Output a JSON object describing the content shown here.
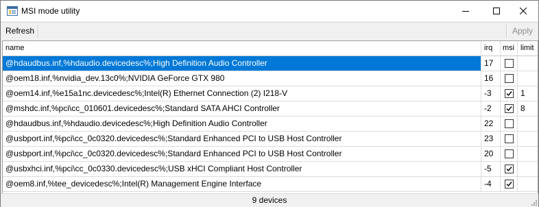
{
  "window": {
    "title": "MSI mode utility",
    "icon": "app-window-icon"
  },
  "toolbar": {
    "refresh_label": "Refresh",
    "apply_label": "Apply"
  },
  "columns": {
    "name": "name",
    "irq": "irq",
    "msi": "msi",
    "limit": "limit"
  },
  "rows": [
    {
      "name": "@hdaudbus.inf,%hdaudio.devicedesc%;High Definition Audio Controller",
      "irq": "17",
      "msi": false,
      "limit": ""
    },
    {
      "name": "@oem18.inf,%nvidia_dev.13c0%;NVIDIA GeForce GTX 980",
      "irq": "16",
      "msi": false,
      "limit": ""
    },
    {
      "name": "@oem14.inf,%e15a1nc.devicedesc%;Intel(R) Ethernet Connection (2) I218-V",
      "irq": "-3",
      "msi": true,
      "limit": "1"
    },
    {
      "name": "@mshdc.inf,%pci\\cc_010601.devicedesc%;Standard SATA AHCI Controller",
      "irq": "-2",
      "msi": true,
      "limit": "8"
    },
    {
      "name": "@hdaudbus.inf,%hdaudio.devicedesc%;High Definition Audio Controller",
      "irq": "22",
      "msi": false,
      "limit": ""
    },
    {
      "name": "@usbport.inf,%pci\\cc_0c0320.devicedesc%;Standard Enhanced PCI to USB Host Controller",
      "irq": "23",
      "msi": false,
      "limit": ""
    },
    {
      "name": "@usbport.inf,%pci\\cc_0c0320.devicedesc%;Standard Enhanced PCI to USB Host Controller",
      "irq": "20",
      "msi": false,
      "limit": ""
    },
    {
      "name": "@usbxhci.inf,%pci\\cc_0c0330.devicedesc%;USB xHCI Compliant Host Controller",
      "irq": "-5",
      "msi": true,
      "limit": ""
    },
    {
      "name": "@oem8.inf,%tee_devicedesc%;Intel(R) Management Engine Interface",
      "irq": "-4",
      "msi": true,
      "limit": ""
    }
  ],
  "selected_row": 0,
  "status": {
    "text": "9 devices"
  },
  "colors": {
    "selection": "#0078d7",
    "title_bg": "#ffffff",
    "chrome_bg": "#f0f0f0",
    "disabled_text": "#8c8c8c"
  }
}
